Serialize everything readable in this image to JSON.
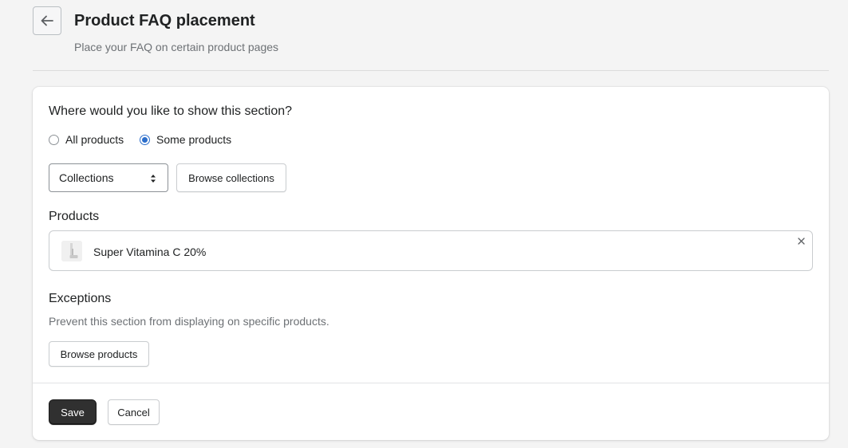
{
  "header": {
    "back_icon": "arrow-left-icon",
    "title": "Product FAQ placement",
    "subtitle": "Place your FAQ on certain product pages"
  },
  "placement": {
    "question": "Where would you like to show this section?",
    "options": [
      {
        "label": "All products",
        "selected": false
      },
      {
        "label": "Some products",
        "selected": true
      }
    ],
    "select": {
      "value": "Collections",
      "icon": "select-arrows-icon"
    },
    "browse_collections_label": "Browse collections"
  },
  "products": {
    "heading": "Products",
    "items": [
      {
        "name": "Super Vitamina C 20%",
        "thumbnail_icon": "product-thumbnail",
        "remove_icon": "close-icon"
      }
    ]
  },
  "exceptions": {
    "heading": "Exceptions",
    "help_text": "Prevent this section from displaying on specific products.",
    "browse_products_label": "Browse products"
  },
  "footer": {
    "save_label": "Save",
    "cancel_label": "Cancel"
  },
  "colors": {
    "accent": "#2c6ecb",
    "primary_button": "#303030",
    "background": "#f4f4f4"
  }
}
